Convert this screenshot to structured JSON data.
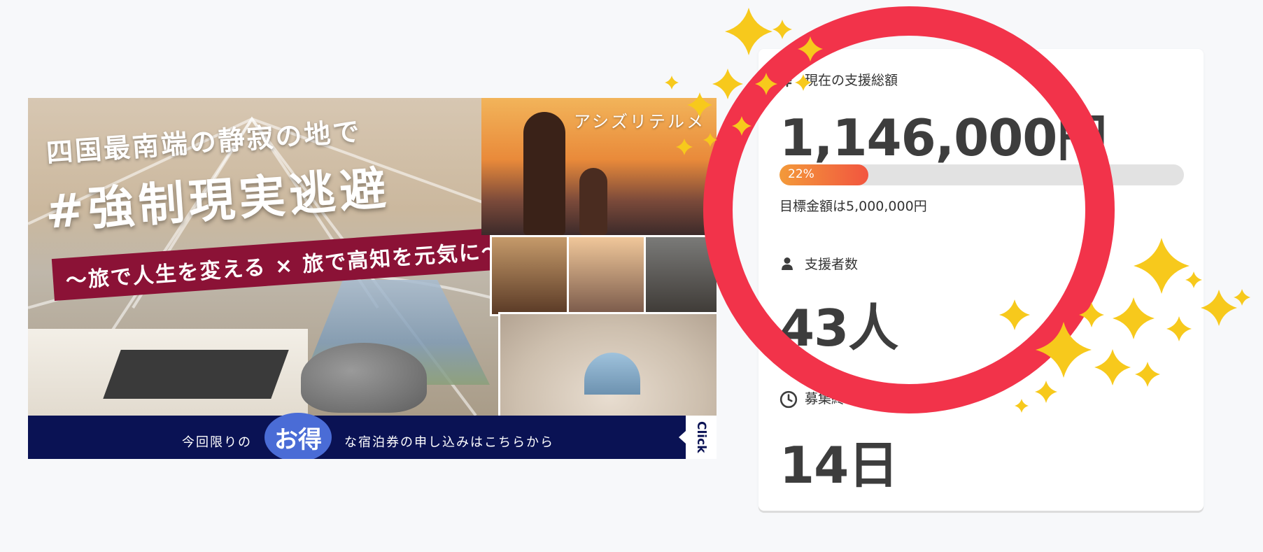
{
  "banner": {
    "headline_line1": "四国最南端の静寂の地で",
    "headline_line2": "#強制現実逃避",
    "tagline": "〜旅で人生を変える × 旅で高知を元気に〜",
    "photo_credit": "アシズリテルメ",
    "cta_pre": "今回限りの",
    "cta_highlight": "お得",
    "cta_post": "な宿泊券の申し込みはこちらから",
    "cta_click": "Click"
  },
  "stats": {
    "total": {
      "label": "現在の支援総額",
      "value": "1,146,000円",
      "progress_percent": 22,
      "progress_text": "22%",
      "goal_text": "目標金額は5,000,000円"
    },
    "supporters": {
      "label": "支援者数",
      "value": "43人"
    },
    "remaining": {
      "label": "募集終了まで残り",
      "value": "14日"
    }
  },
  "colors": {
    "background": "#f7f8fa",
    "card": "#ffffff",
    "text": "#3d3d3d",
    "progress_start": "#f39a3a",
    "progress_end": "#f2553f",
    "progress_track": "#e2e2e2",
    "highlight_circle": "#f2334a",
    "sparkle": "#f7c91c",
    "cta_bar": "#0a1254",
    "tagline_bg": "#8b1236"
  },
  "icons": {
    "total": "yen-icon",
    "supporters": "user-icon",
    "remaining": "clock-icon"
  }
}
